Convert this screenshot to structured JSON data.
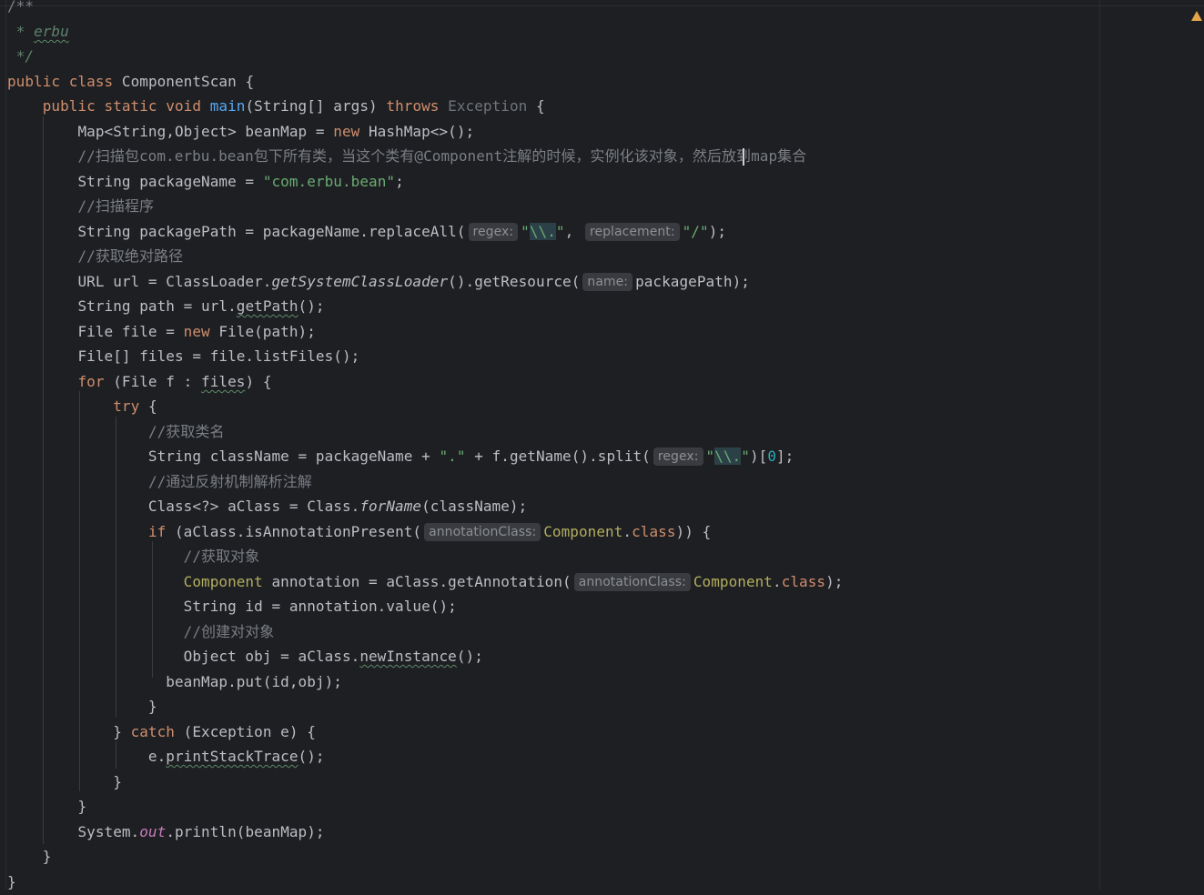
{
  "editor": {
    "doc_author": "erbu",
    "class_name": "ComponentScan",
    "comments": {
      "scan": "//扫描包com.erbu.bean包下所有类，当这个类有@Component注解的时候，实例化该对象，然后放到map集合",
      "scan_prog": "//扫描程序",
      "abs_path": "//获取绝对路径",
      "get_class_name": "//获取类名",
      "reflect": "//通过反射机制解析注解",
      "get_object": "//获取对象",
      "create_object": "//创建对对象"
    },
    "hints": {
      "regex": "regex:",
      "replacement": "replacement:",
      "name": "name:",
      "annotation_class": "annotationClass:"
    },
    "strings": {
      "package": "\"com.erbu.bean\"",
      "dot": "\".\"",
      "slash": "\"/\""
    },
    "numbers": {
      "index": "0"
    }
  }
}
